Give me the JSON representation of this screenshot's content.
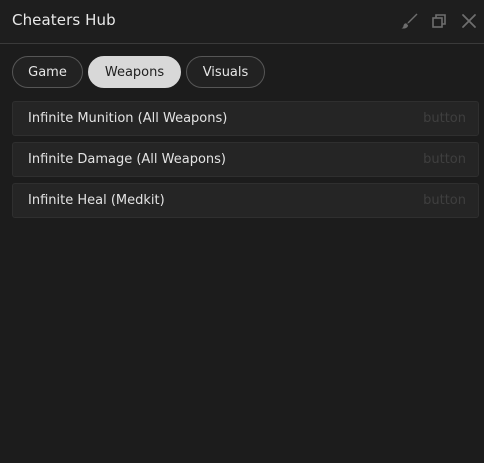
{
  "window": {
    "title": "Cheaters Hub",
    "icons": [
      "brush-icon",
      "restore-icon",
      "close-icon"
    ]
  },
  "tabs": [
    {
      "label": "Game",
      "active": false
    },
    {
      "label": "Weapons",
      "active": true
    },
    {
      "label": "Visuals",
      "active": false
    }
  ],
  "items": [
    {
      "label": "Infinite Munition (All Weapons)",
      "hint": "button"
    },
    {
      "label": "Infinite Damage (All Weapons)",
      "hint": "button"
    },
    {
      "label": "Infinite Heal (Medkit)",
      "hint": "button"
    }
  ],
  "colors": {
    "background": "#1c1c1c",
    "item_background": "#252525",
    "active_tab": "#d8d8d8",
    "text": "#e6e6e6"
  }
}
